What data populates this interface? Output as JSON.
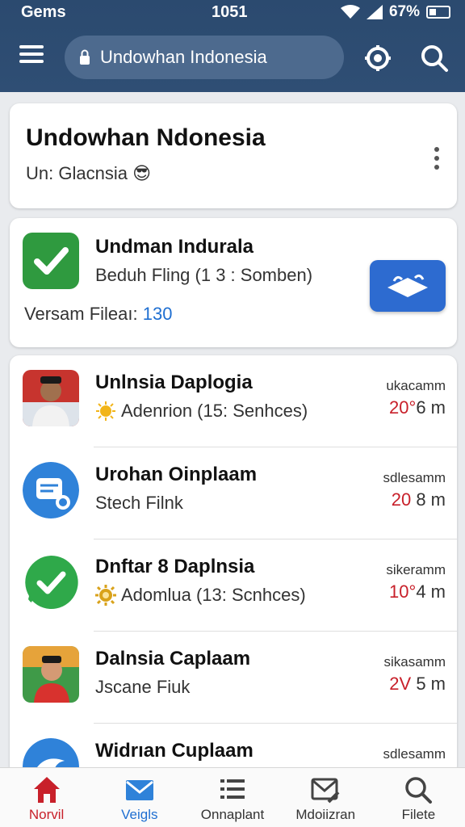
{
  "status_bar": {
    "carrier": "Gems",
    "time": "1051",
    "battery": "67%"
  },
  "search": {
    "query": "Undowhan Indonesia"
  },
  "header_card": {
    "title": "Undowhan Ndonesia",
    "subtitle": "Un: Glacnsia",
    "emoji": "😎"
  },
  "feature_card": {
    "title": "Undman Indurala",
    "subtitle": "Beduh Fling (1 3 : Somben)",
    "meta_label": "Versam Fileaı:",
    "meta_value": "130"
  },
  "list": [
    {
      "name": "Unlnsia Daplogia",
      "sub": "Adenrion (15: Senhces)",
      "sub_icon": "sun-icon",
      "right_label": "ukacamm",
      "right_red": "20°",
      "right_rest": "6 m",
      "avatar": "person-photo"
    },
    {
      "name": "Urohan Oinplaam",
      "sub": "Stech Filnk",
      "sub_icon": "",
      "right_label": "sdlesamm",
      "right_red": "20",
      "right_rest": "8 m",
      "avatar": "chat-bubble-blue"
    },
    {
      "name": "Dnftar 8 Daplnsia",
      "sub": "Adomlua (13: Scnhces)",
      "sub_icon": "sun-gear-icon",
      "right_label": "sikeramm",
      "right_red": "10°",
      "right_rest": "4 m",
      "avatar": "check-bubble-green"
    },
    {
      "name": "Dalnsia Caplaam",
      "sub": "Jscane Fiuk",
      "sub_icon": "",
      "right_label": "sikasamm",
      "right_red": "2V",
      "right_rest": "5 m",
      "avatar": "child-photo"
    },
    {
      "name": "Widrıan Cuplaam",
      "sub": "",
      "sub_icon": "",
      "right_label": "sdlesamm",
      "right_red": "",
      "right_rest": "",
      "avatar": "bird-blue"
    }
  ],
  "bottom_nav": [
    {
      "label": "Norvil",
      "icon": "home-icon",
      "color": "#c8202a"
    },
    {
      "label": "Veigls",
      "icon": "mail-icon",
      "color": "#1f6fd1"
    },
    {
      "label": "Onnaplant",
      "icon": "list-icon",
      "color": "#333333"
    },
    {
      "label": "Mdoiizran",
      "icon": "edit-mail-icon",
      "color": "#333333"
    },
    {
      "label": "Filete",
      "icon": "search-icon",
      "color": "#333333"
    }
  ],
  "colors": {
    "topbar": "#2b4a6f",
    "accent_blue": "#1f6fd1",
    "accent_red": "#c8202a",
    "green": "#2f9a3f"
  }
}
